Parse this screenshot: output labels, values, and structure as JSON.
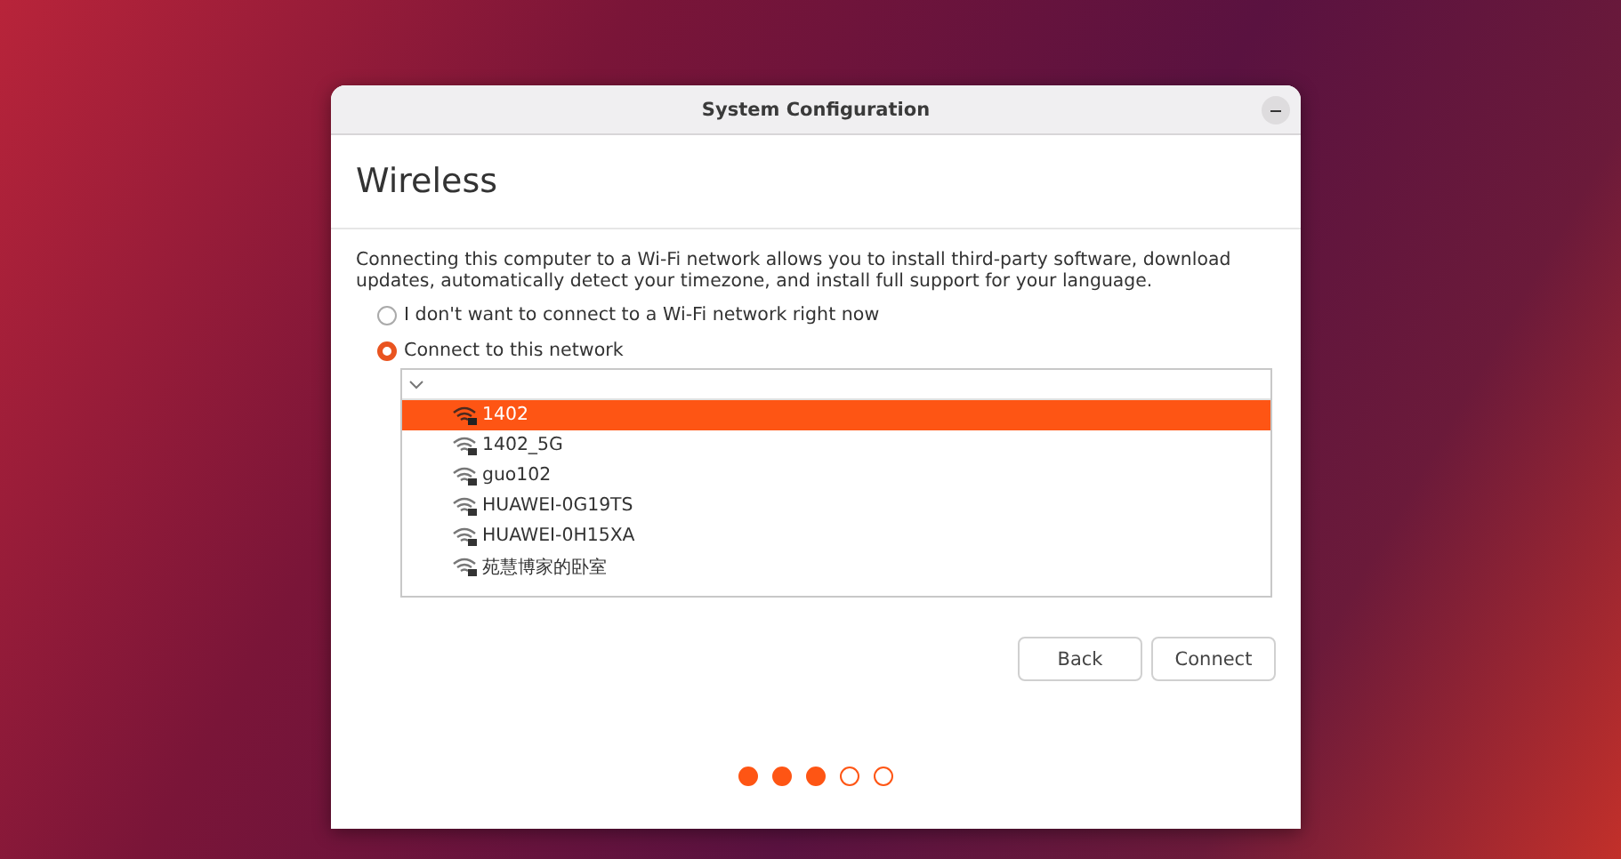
{
  "window": {
    "title": "System Configuration"
  },
  "page_title": "Wireless",
  "description": "Connecting this computer to a Wi-Fi network allows you to install third-party software, download updates, automatically detect your timezone, and install full support for your language.",
  "options": [
    {
      "label": "I don't want to connect to a Wi-Fi network right now",
      "selected": false
    },
    {
      "label": "Connect to this network",
      "selected": true
    }
  ],
  "networks": [
    {
      "name": "1402",
      "selected": true
    },
    {
      "name": "1402_5G",
      "selected": false
    },
    {
      "name": "guo102",
      "selected": false
    },
    {
      "name": "HUAWEI-0G19TS",
      "selected": false
    },
    {
      "name": "HUAWEI-0H15XA",
      "selected": false
    },
    {
      "name": "苑慧博家的卧室",
      "selected": false
    }
  ],
  "buttons": [
    "Back",
    "Connect"
  ],
  "steps": [
    {
      "done": true
    },
    {
      "done": true
    },
    {
      "done": true
    },
    {
      "done": false
    },
    {
      "done": false
    }
  ]
}
